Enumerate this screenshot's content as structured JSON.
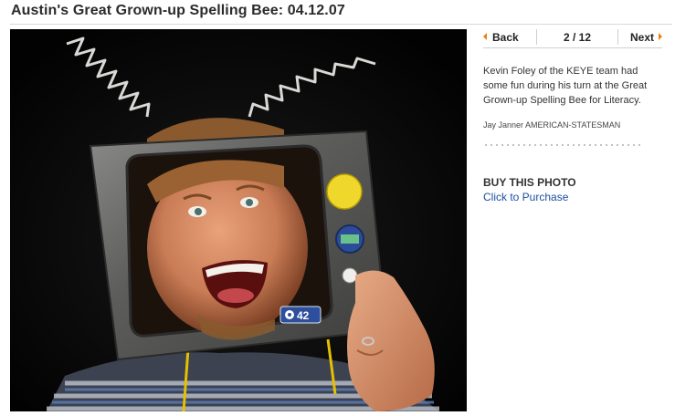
{
  "page": {
    "title": "Austin's Great Grown-up Spelling Bee: 04.12.07"
  },
  "pager": {
    "back_label": "Back",
    "counter": "2 / 12",
    "next_label": "Next",
    "arrow_color": "#e8830c"
  },
  "photo": {
    "tv_logo_text": "42"
  },
  "sidebar": {
    "caption": "Kevin Foley of the KEYE team had some fun during his turn at the Great Grown-up Spelling Bee for Literacy.",
    "credit": "Jay Janner AMERICAN-STATESMAN",
    "buy_heading": "BUY THIS PHOTO",
    "buy_link": "Click to Purchase",
    "link_color": "#1a4f9c"
  }
}
